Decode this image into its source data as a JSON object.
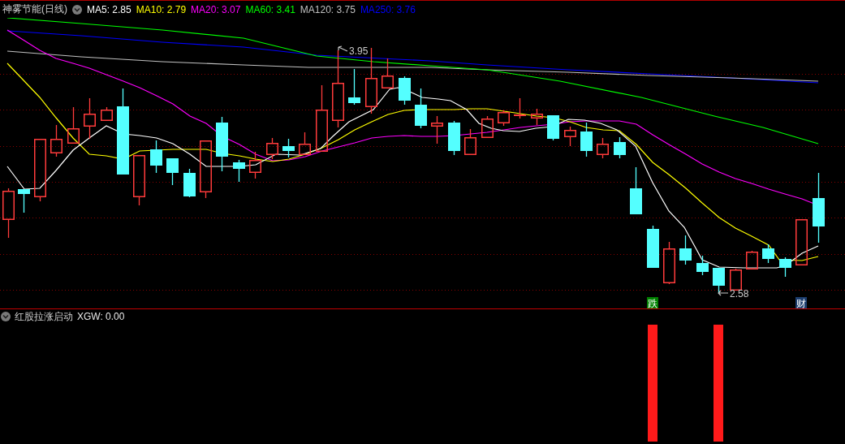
{
  "price_panel": {
    "title": "神雾节能(日线)",
    "indicators": [
      {
        "label": "MA5: 2.85",
        "color": "#ffffff"
      },
      {
        "label": "MA10: 2.79",
        "color": "#ffff00"
      },
      {
        "label": "MA20: 3.07",
        "color": "#ff00ff"
      },
      {
        "label": "MA60: 3.41",
        "color": "#00ff00"
      },
      {
        "label": "MA120: 3.75",
        "color": "#c0c0c0"
      },
      {
        "label": "MA250: 3.76",
        "color": "#0000ff"
      }
    ],
    "high_label": "3.95",
    "low_label": "2.58",
    "markers": [
      {
        "text": "跌",
        "color": "#008000"
      },
      {
        "text": "财",
        "color": "#1c3d6e"
      }
    ]
  },
  "indicator_panel": {
    "title": "红股拉涨启动",
    "reading": "XGW: 0.00"
  }
}
